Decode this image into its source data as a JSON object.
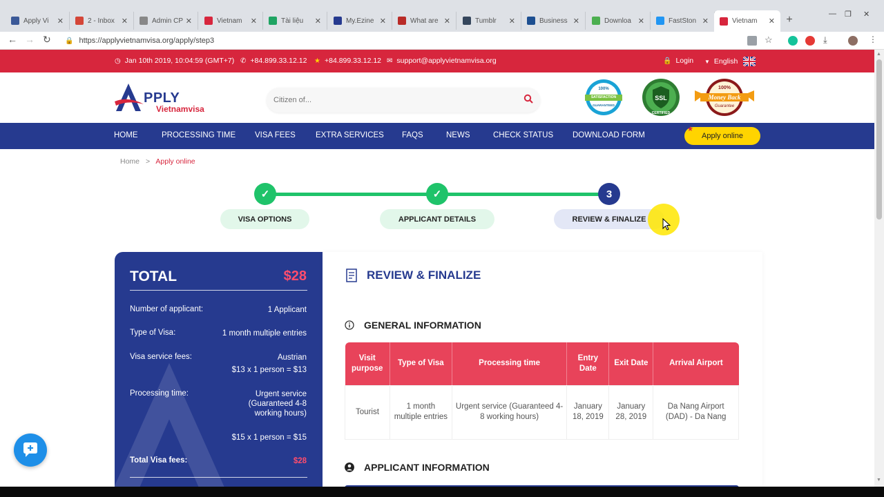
{
  "browser": {
    "tabs": [
      {
        "title": "Apply Vi",
        "color": "#3b5998"
      },
      {
        "title": "2 - Inbox",
        "color": "#d44638"
      },
      {
        "title": "Admin CP",
        "color": "#888888"
      },
      {
        "title": "Vietnam",
        "color": "#d7263d"
      },
      {
        "title": "Tài liệu",
        "color": "#1fa463"
      },
      {
        "title": "My.Ezine",
        "color": "#263a8f"
      },
      {
        "title": "What are",
        "color": "#b92b27"
      },
      {
        "title": "Tumblr",
        "color": "#35465c"
      },
      {
        "title": "Business",
        "color": "#1d4f91"
      },
      {
        "title": "Downloa",
        "color": "#4caf50"
      },
      {
        "title": "FastSton",
        "color": "#2196f3"
      },
      {
        "title": "Vietnam",
        "color": "#d7263d"
      }
    ],
    "url": "https://applyvietnamvisa.org/apply/step3"
  },
  "topbar": {
    "datetime": "Jan 10th 2019, 10:04:59 (GMT+7)",
    "phone1": "+84.899.33.12.12",
    "phone2": "+84.899.33.12.12",
    "email": "support@applyvietnamvisa.org",
    "login": "Login",
    "language": "English"
  },
  "header": {
    "logo_main": "PPLY",
    "logo_sub": "Vietnamvisa",
    "search_placeholder": "Citizen of...",
    "badge1_top": "100%",
    "badge1_mid": "SATISFACTION",
    "badge1_bot": "GUARANTEED",
    "badge2": "SSL",
    "badge2_bot": "CERTIFIED",
    "badge3_top": "100%",
    "badge3_mid": "Money Back",
    "badge3_bot": "Guarantee"
  },
  "nav": {
    "items": [
      "HOME",
      "PROCESSING TIME",
      "VISA FEES",
      "EXTRA SERVICES",
      "FAQS",
      "NEWS",
      "CHECK STATUS",
      "DOWNLOAD FORM"
    ],
    "apply": "Apply online"
  },
  "breadcrumb": {
    "home": "Home",
    "sep": ">",
    "current": "Apply online"
  },
  "stepper": {
    "steps": [
      {
        "label": "VISA OPTIONS",
        "mark": "✓"
      },
      {
        "label": "APPLICANT DETAILS",
        "mark": "✓"
      },
      {
        "label": "REVIEW & FINALIZE",
        "mark": "3"
      }
    ]
  },
  "total": {
    "title": "TOTAL",
    "amount": "$28",
    "rows": {
      "applicants_label": "Number of applicant:",
      "applicants_value": "1 Applicant",
      "visa_type_label": "Type of Visa:",
      "visa_type_value": "1 month multiple entries",
      "service_label": "Visa service fees:",
      "service_value1": "Austrian",
      "service_value2": "$13 x 1 person = $13",
      "processing_label": "Processing time:",
      "processing_value1": "Urgent service",
      "processing_value2": "(Guaranteed 4-8",
      "processing_value3": "working hours)",
      "processing_calc": "$15 x 1 person = $15",
      "fees_label": "Total Visa fees:",
      "fees_value": "$28"
    }
  },
  "review": {
    "title": "REVIEW & FINALIZE",
    "general_title": "GENERAL INFORMATION",
    "columns": [
      "Visit purpose",
      "Type of Visa",
      "Processing time",
      "Entry Date",
      "Exit Date",
      "Arrival Airport"
    ],
    "row": [
      "Tourist",
      "1 month multiple entries",
      "Urgent service (Guaranteed 4-8 working hours)",
      "January 18, 2019",
      "January 28, 2019",
      "Da Nang Airport (DAD) - Da Nang"
    ],
    "applicant_title": "APPLICANT INFORMATION"
  },
  "colors": {
    "red": "#d7263d",
    "navy": "#263a8f",
    "green": "#1fc36a",
    "yellow": "#ffd400",
    "table_header": "#e8435a"
  }
}
